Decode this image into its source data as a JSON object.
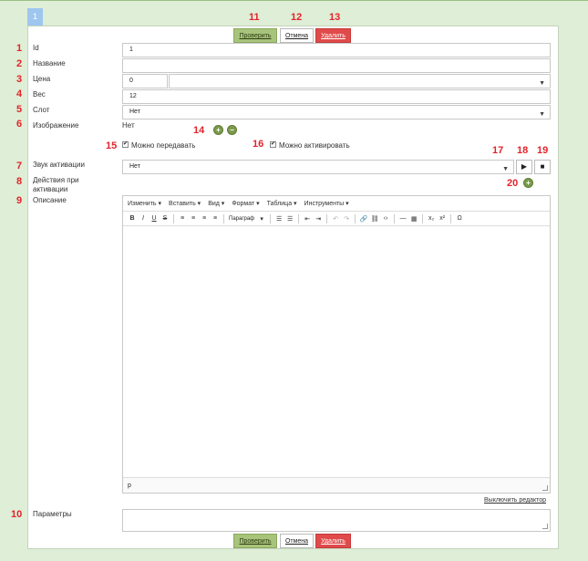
{
  "tab": {
    "label": "1"
  },
  "actions": {
    "check": "Проверить",
    "cancel": "Отмена",
    "delete": "Удалить"
  },
  "markers": {
    "n1": "1",
    "n2": "2",
    "n3": "3",
    "n4": "4",
    "n5": "5",
    "n6": "6",
    "n7": "7",
    "n8": "8",
    "n9": "9",
    "n10": "10",
    "n11": "11",
    "n12": "12",
    "n13": "13",
    "n14": "14",
    "n15": "15",
    "n16": "16",
    "n17": "17",
    "n18": "18",
    "n19": "19",
    "n20": "20"
  },
  "fields": {
    "id": {
      "label": "Id",
      "value": "1"
    },
    "name": {
      "label": "Название",
      "value": ""
    },
    "price": {
      "label": "Цена",
      "value": "0",
      "currency": ""
    },
    "weight": {
      "label": "Вес",
      "value": "12"
    },
    "slot": {
      "label": "Слот",
      "value": "Нет"
    },
    "image": {
      "label": "Изображение",
      "value": "Нет"
    },
    "transferable": {
      "label": "Можно передавать",
      "checked": true
    },
    "activatable": {
      "label": "Можно активировать",
      "checked": true
    },
    "activation_sound": {
      "label": "Звук активации",
      "value": "Нет"
    },
    "activation_actions": {
      "label_line1": "Действия при",
      "label_line2": "активации"
    },
    "description": {
      "label": "Описание"
    },
    "params": {
      "label": "Параметры",
      "value": ""
    }
  },
  "editor": {
    "menus": [
      "Изменить ▾",
      "Вставить ▾",
      "Вид ▾",
      "Формат ▾",
      "Таблица ▾",
      "Инструменты ▾"
    ],
    "paragraph_select": "Параграф",
    "status_path": "p",
    "disable_link": "Выключить редактор"
  },
  "icons": {
    "add": "plus-icon",
    "remove": "minus-icon",
    "play": "play-icon",
    "stop": "stop-icon",
    "dropdown": "chevron-down-icon"
  },
  "colors": {
    "background": "#dfeed6",
    "check": "#a8c47a",
    "delete": "#e04a4a",
    "marker": "#e3232b",
    "tab": "#9fc6ee"
  }
}
